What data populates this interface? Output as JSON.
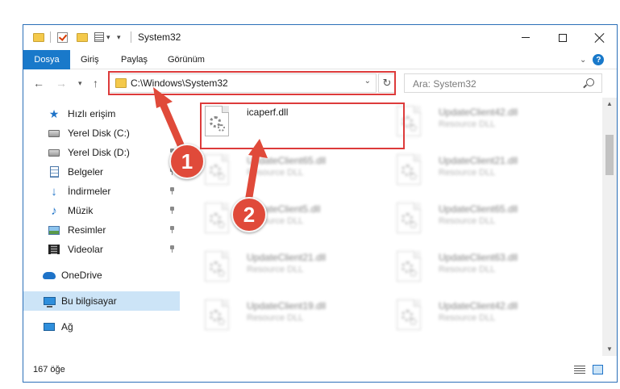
{
  "window": {
    "title": "System32"
  },
  "ribbon": {
    "tabs": [
      "Dosya",
      "Giriş",
      "Paylaş",
      "Görünüm"
    ],
    "help": "?"
  },
  "address": {
    "path": "C:\\Windows\\System32"
  },
  "search": {
    "placeholder": "Ara: System32"
  },
  "sidebar": {
    "items": [
      {
        "label": "Hızlı erişim",
        "icon": "star-icon"
      },
      {
        "label": "Yerel Disk (C:)",
        "icon": "drive-icon"
      },
      {
        "label": "Yerel Disk (D:)",
        "icon": "drive-icon"
      },
      {
        "label": "Belgeler",
        "icon": "documents-icon"
      },
      {
        "label": "İndirmeler",
        "icon": "download-icon"
      },
      {
        "label": "Müzik",
        "icon": "music-icon"
      },
      {
        "label": "Resimler",
        "icon": "pictures-icon"
      },
      {
        "label": "Videolar",
        "icon": "videos-icon"
      },
      {
        "label": "OneDrive",
        "icon": "cloud-icon"
      },
      {
        "label": "Bu bilgisayar",
        "icon": "computer-icon",
        "selected": true
      },
      {
        "label": "Ağ",
        "icon": "network-icon"
      }
    ]
  },
  "files": [
    {
      "name": "icaperf.dll",
      "type": ""
    },
    {
      "name": "UpdateClient42.dll",
      "type": "Resource DLL"
    },
    {
      "name": "UpdateClient65.dll",
      "type": "Resource DLL"
    },
    {
      "name": "UpdateClient21.dll",
      "type": "Resource DLL"
    },
    {
      "name": "UpdateClient5.dll",
      "type": "Resource DLL"
    },
    {
      "name": "UpdateClient65.dll",
      "type": "Resource DLL"
    },
    {
      "name": "UpdateClient21.dll",
      "type": "Resource DLL"
    },
    {
      "name": "UpdateClient63.dll",
      "type": "Resource DLL"
    },
    {
      "name": "UpdateClient19.dll",
      "type": "Resource DLL"
    },
    {
      "name": "UpdateClient42.dll",
      "type": "Resource DLL"
    }
  ],
  "status": {
    "count": "167 öğe"
  },
  "annotations": {
    "badge1": "1",
    "badge2": "2"
  },
  "colors": {
    "accent": "#1979ca",
    "highlight": "#dd3b3b",
    "selected": "#cce4f7"
  }
}
